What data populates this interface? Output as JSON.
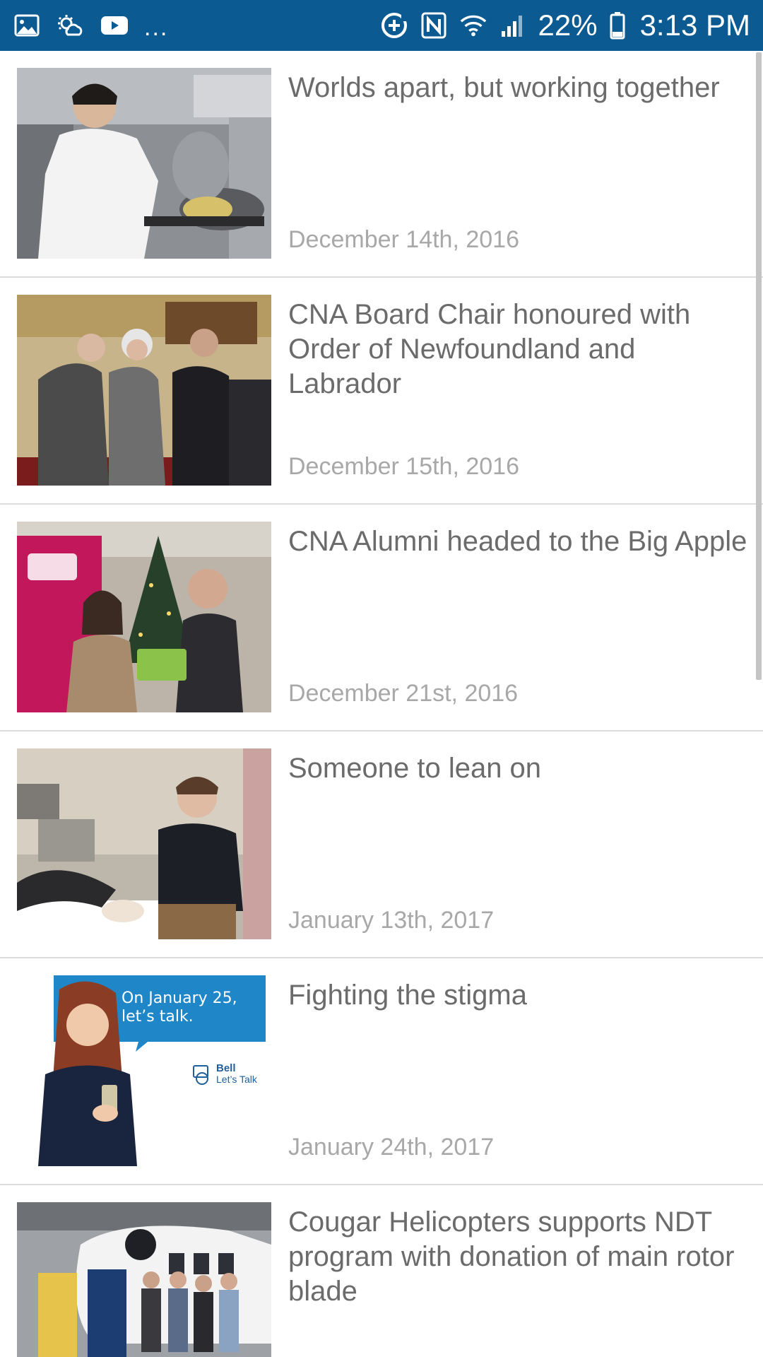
{
  "status_bar": {
    "left_icons": [
      "gallery-icon",
      "weather-icon",
      "youtube-icon"
    ],
    "overflow": "...",
    "right_icons": [
      "data-saver-icon",
      "nfc-icon",
      "wifi-icon",
      "signal-icon"
    ],
    "battery_percent": "22%",
    "time": "3:13 PM",
    "bg_color": "#0b5a91"
  },
  "news": [
    {
      "title": "Worlds apart, but working together",
      "date": "December 14th, 2016"
    },
    {
      "title": "CNA Board Chair honoured with Order of Newfoundland and Labrador",
      "date": "December 15th, 2016"
    },
    {
      "title": "CNA Alumni headed to the Big Apple",
      "date": "December 21st, 2016"
    },
    {
      "title": "Someone to lean on",
      "date": "January 13th, 2017"
    },
    {
      "title": "Fighting the stigma",
      "date": "January 24th, 2017",
      "thumb_text": {
        "bubble": "On January 25, let’s talk.",
        "brand_top": "Bell",
        "brand_bottom": "Let’s Talk"
      }
    },
    {
      "title": "Cougar Helicopters supports NDT program with donation of main rotor blade",
      "date": ""
    }
  ],
  "colors": {
    "title_text": "#6b6b6b",
    "date_text": "#a8a8a8",
    "divider": "#dcdcdc"
  }
}
